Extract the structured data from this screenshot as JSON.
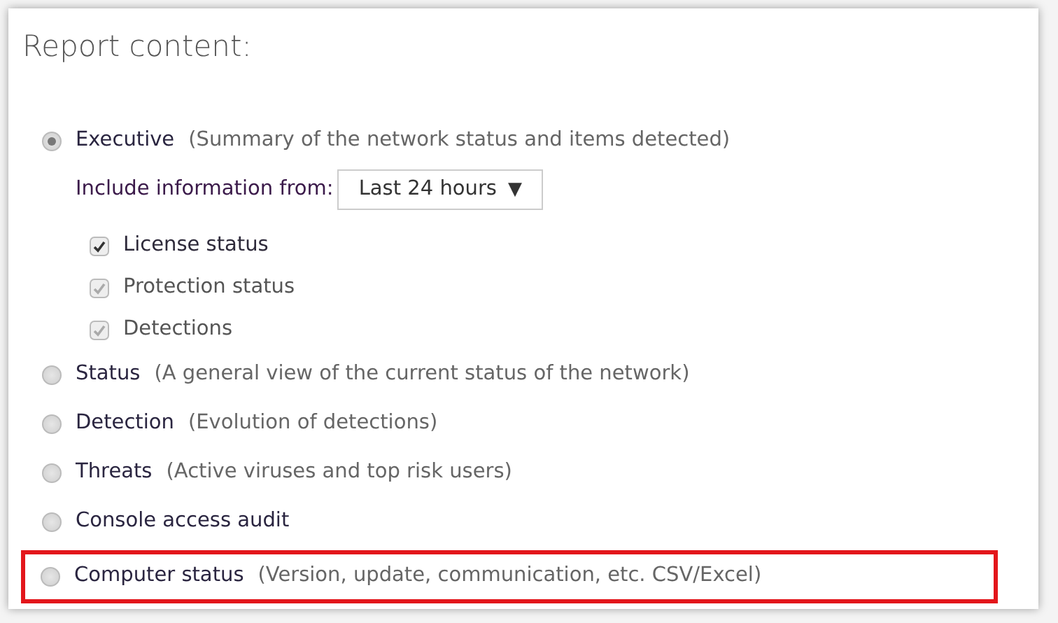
{
  "title": "Report content:",
  "options": [
    {
      "name": "Executive",
      "description": "(Summary of the network status and items detected)",
      "selected": true,
      "highlighted": false,
      "include": {
        "label": "Include information from:",
        "value": "Last 24 hours",
        "arrow": "▼"
      },
      "checkboxes": [
        {
          "label": "License status",
          "checked": true,
          "disabled": false
        },
        {
          "label": "Protection status",
          "checked": true,
          "disabled": true
        },
        {
          "label": "Detections",
          "checked": true,
          "disabled": true
        }
      ]
    },
    {
      "name": "Status",
      "description": "(A general view of the current status of the network)",
      "selected": false,
      "highlighted": false
    },
    {
      "name": "Detection",
      "description": "(Evolution of detections)",
      "selected": false,
      "highlighted": false
    },
    {
      "name": "Threats",
      "description": "(Active viruses and top risk users)",
      "selected": false,
      "highlighted": false
    },
    {
      "name": "Console access audit",
      "selected": false,
      "highlighted": false
    },
    {
      "name": "Computer status",
      "description": "(Version, update, communication, etc. CSV/Excel)",
      "selected": false,
      "highlighted": true
    }
  ]
}
